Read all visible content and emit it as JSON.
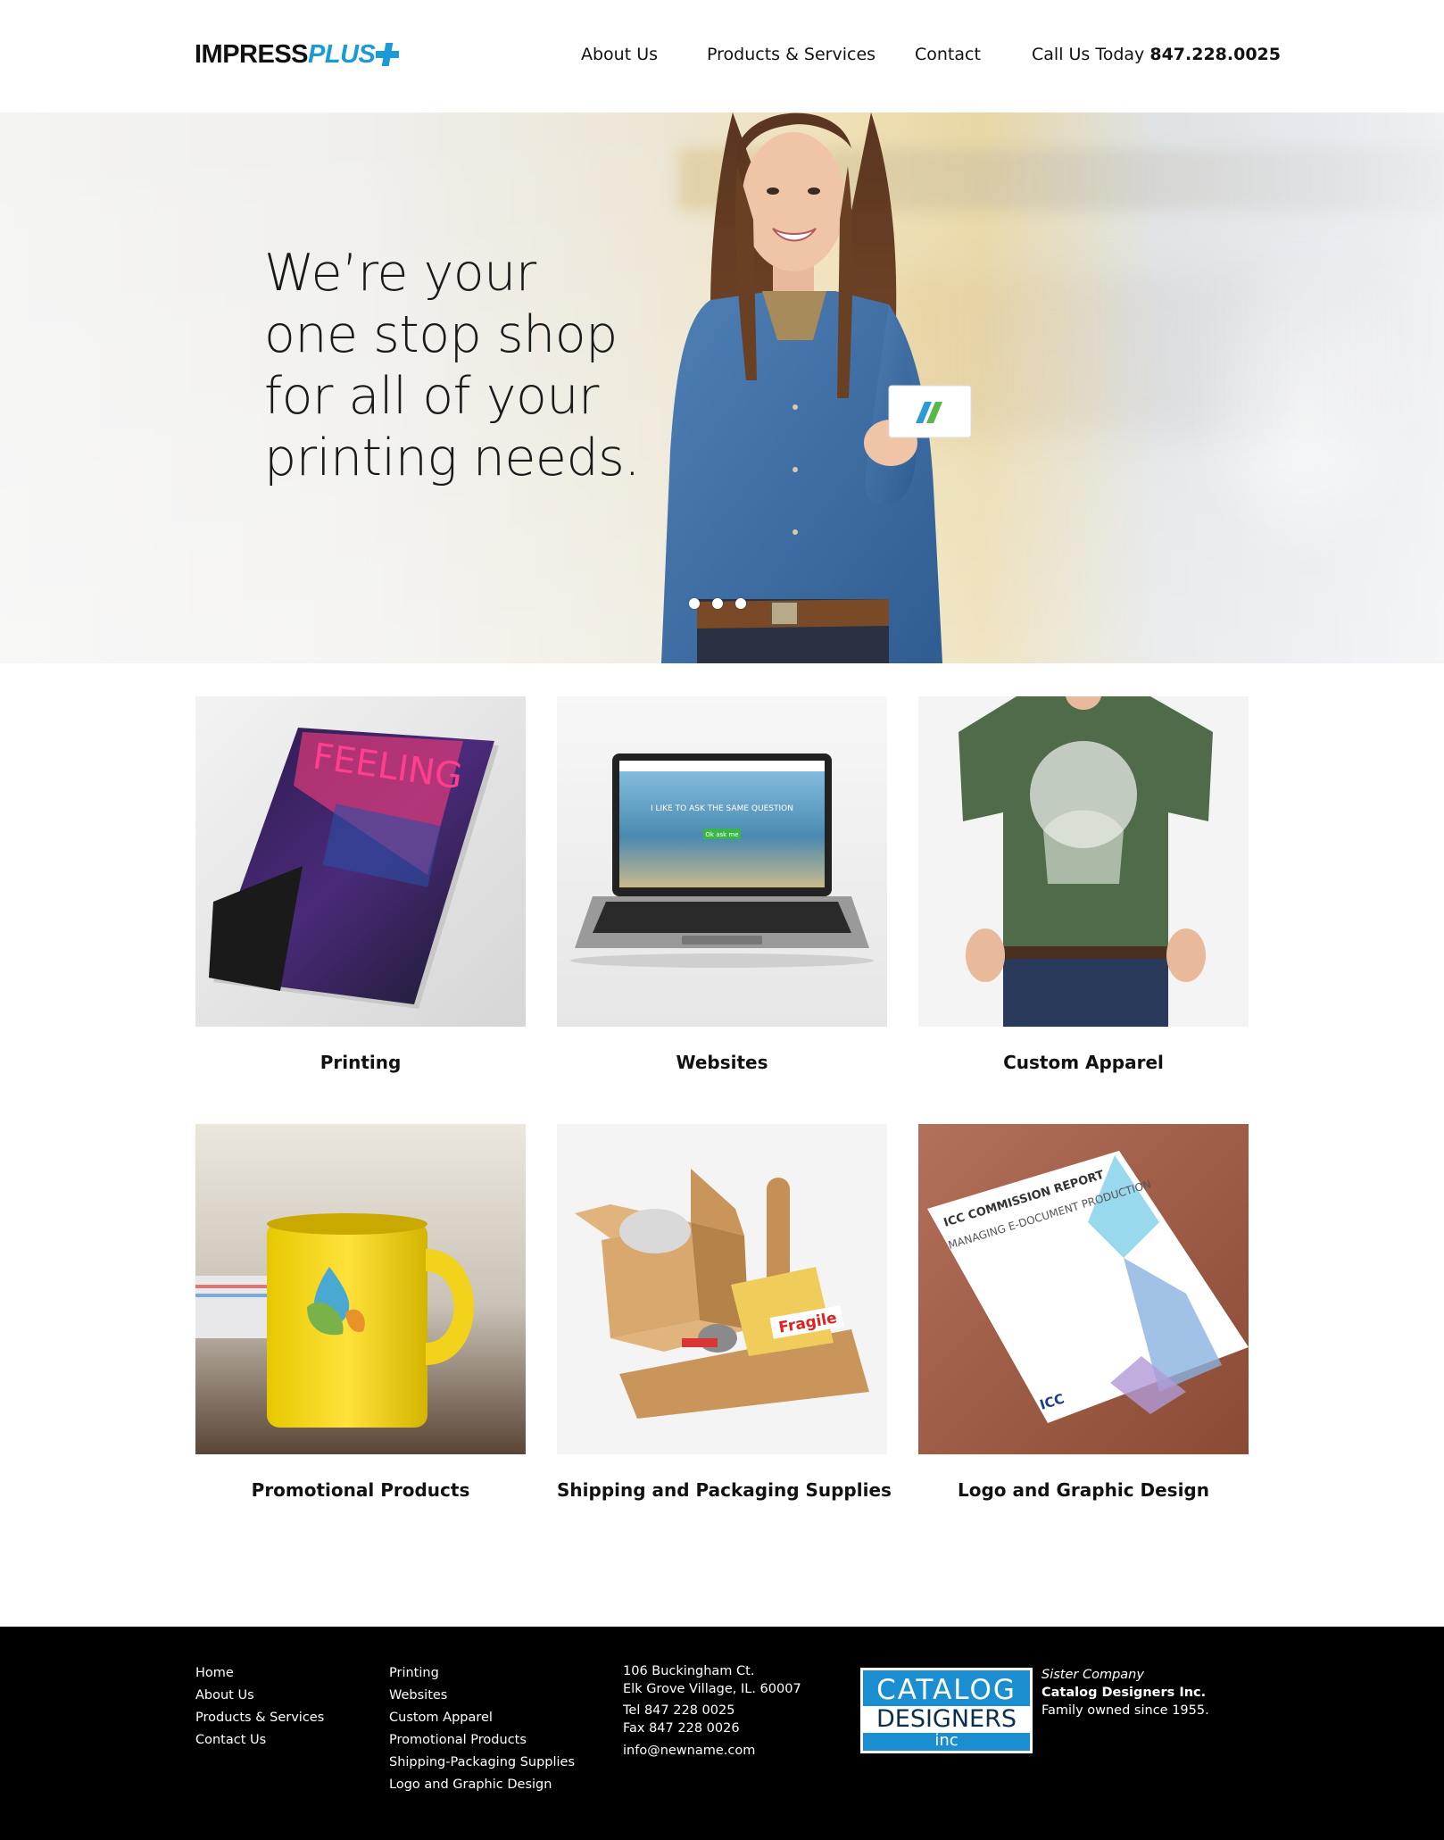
{
  "brand": {
    "name_part1": "IMPRESS",
    "name_part2": "PLUS",
    "accent_color": "#1c9ad6"
  },
  "nav": {
    "items": [
      {
        "label": "About Us"
      },
      {
        "label": "Products & Services"
      },
      {
        "label": "Contact"
      }
    ],
    "phone_prefix": "Call Us Today ",
    "phone_number": "847.228.0025"
  },
  "hero": {
    "headline_lines": [
      "We’re your",
      "one stop shop",
      "for all of your",
      "printing needs."
    ],
    "slides": 3,
    "active_slide": 1
  },
  "services": [
    {
      "label": "Printing",
      "icon": "magazine-icon"
    },
    {
      "label": "Websites",
      "icon": "laptop-icon"
    },
    {
      "label": "Custom Apparel",
      "icon": "tshirt-icon"
    },
    {
      "label": "Promotional Products",
      "icon": "mug-icon"
    },
    {
      "label": "Shipping and Packaging Supplies",
      "icon": "box-icon"
    },
    {
      "label": "Logo and Graphic Design",
      "icon": "brochure-icon"
    }
  ],
  "tile_text": {
    "magazine_title": "FEELING",
    "laptop_headline": "I LIKE TO ASK THE SAME QUESTION",
    "laptop_button": "Ok ask me",
    "fragile": "Fragile",
    "brochure_title": "ICC COMMISSION REPORT",
    "brochure_subtitle": "MANAGING E-DOCUMENT PRODUCTION",
    "brochure_logo": "ICC"
  },
  "footer": {
    "nav_links": [
      "Home",
      "About Us",
      "Products & Services",
      "Contact Us"
    ],
    "service_links": [
      "Printing",
      "Websites",
      "Custom Apparel",
      "Promotional Products",
      "Shipping-Packaging Supplies",
      "Logo and Graphic Design"
    ],
    "address_line1": "106 Buckingham Ct.",
    "address_line2": "Elk Grove Village, IL. 60007",
    "tel": "Tel 847 228 0025",
    "fax": "Fax 847 228 0026",
    "email": "info@newname.com",
    "sister_logo": {
      "line1": "CATALOG",
      "line2": "DESIGNERS",
      "line3": "inc"
    },
    "sister_label": "Sister Company",
    "sister_name": "Catalog Designers Inc.",
    "sister_tagline": "Family owned since 1955."
  }
}
